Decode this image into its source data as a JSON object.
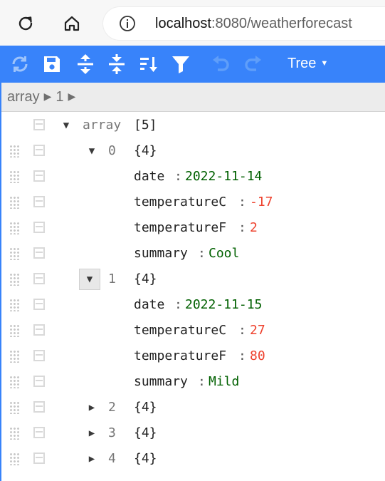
{
  "browser": {
    "url_host": "localhost",
    "url_rest": ":8080/weatherforecast"
  },
  "editor": {
    "mode_label": "Tree",
    "breadcrumb": [
      "array",
      "1"
    ]
  },
  "colors": {
    "accent": "#3883fa",
    "string_value": "#006000",
    "number_value": "#ee422e"
  },
  "tree": {
    "root": {
      "name": "array",
      "count": "[5]"
    },
    "items": [
      {
        "index": "0",
        "count": "{4}",
        "expanded": true,
        "fields": [
          {
            "key": "date",
            "value": "2022-11-14",
            "type": "string"
          },
          {
            "key": "temperatureC",
            "value": "-17",
            "type": "number"
          },
          {
            "key": "temperatureF",
            "value": "2",
            "type": "number"
          },
          {
            "key": "summary",
            "value": "Cool",
            "type": "string"
          }
        ]
      },
      {
        "index": "1",
        "count": "{4}",
        "expanded": true,
        "selected": true,
        "fields": [
          {
            "key": "date",
            "value": "2022-11-15",
            "type": "string"
          },
          {
            "key": "temperatureC",
            "value": "27",
            "type": "number"
          },
          {
            "key": "temperatureF",
            "value": "80",
            "type": "number"
          },
          {
            "key": "summary",
            "value": "Mild",
            "type": "string"
          }
        ]
      },
      {
        "index": "2",
        "count": "{4}",
        "expanded": false
      },
      {
        "index": "3",
        "count": "{4}",
        "expanded": false
      },
      {
        "index": "4",
        "count": "{4}",
        "expanded": false
      }
    ]
  }
}
